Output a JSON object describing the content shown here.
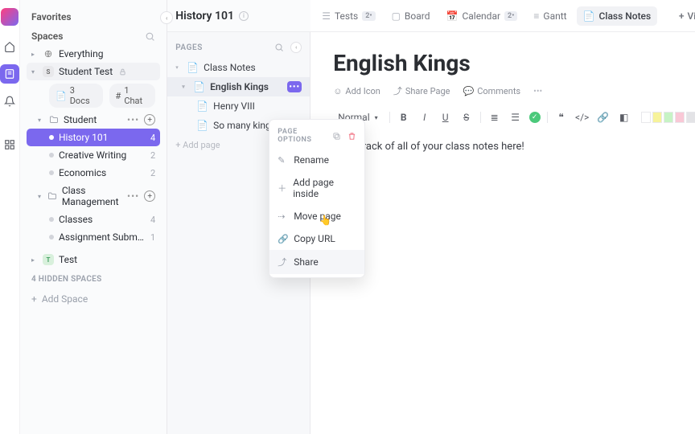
{
  "sidebar": {
    "favorites_label": "Favorites",
    "spaces_label": "Spaces",
    "everything": "Everything",
    "student_test": "Student Test",
    "docs_pill": "3 Docs",
    "chat_pill": "1 Chat",
    "student": "Student",
    "history": "History 101",
    "history_count": "4",
    "creative": "Creative Writing",
    "creative_count": "2",
    "economics": "Economics",
    "economics_count": "2",
    "class_mgmt": "Class Management",
    "classes": "Classes",
    "classes_count": "4",
    "assign": "Assignment Submissio...",
    "assign_count": "1",
    "test": "Test",
    "hidden": "4 HIDDEN SPACES",
    "add_space": "Add Space"
  },
  "pages": {
    "title": "History 101",
    "label": "PAGES",
    "class_notes": "Class Notes",
    "english_kings": "English Kings",
    "henry": "Henry VIII",
    "so_many": "So many kings!",
    "add_page": "+ Add page"
  },
  "menu": {
    "header": "PAGE OPTIONS",
    "rename": "Rename",
    "add_inside": "Add page inside",
    "move": "Move page",
    "copy_url": "Copy URL",
    "share": "Share"
  },
  "tabs": {
    "tests": "Tests",
    "tests_badge": "2•",
    "board": "Board",
    "calendar": "Calendar",
    "calendar_badge": "2•",
    "gantt": "Gantt",
    "class_notes": "Class Notes",
    "add_view": "View"
  },
  "doc": {
    "title": "English Kings",
    "add_icon": "Add Icon",
    "share_page": "Share Page",
    "comments": "Comments",
    "normal": "Normal",
    "body": "Keep track of all of your class notes here!"
  },
  "swatches": [
    "#ffffff",
    "#f7f39b",
    "#c7f3c5",
    "#f9c8d6",
    "#e3e3e6"
  ]
}
